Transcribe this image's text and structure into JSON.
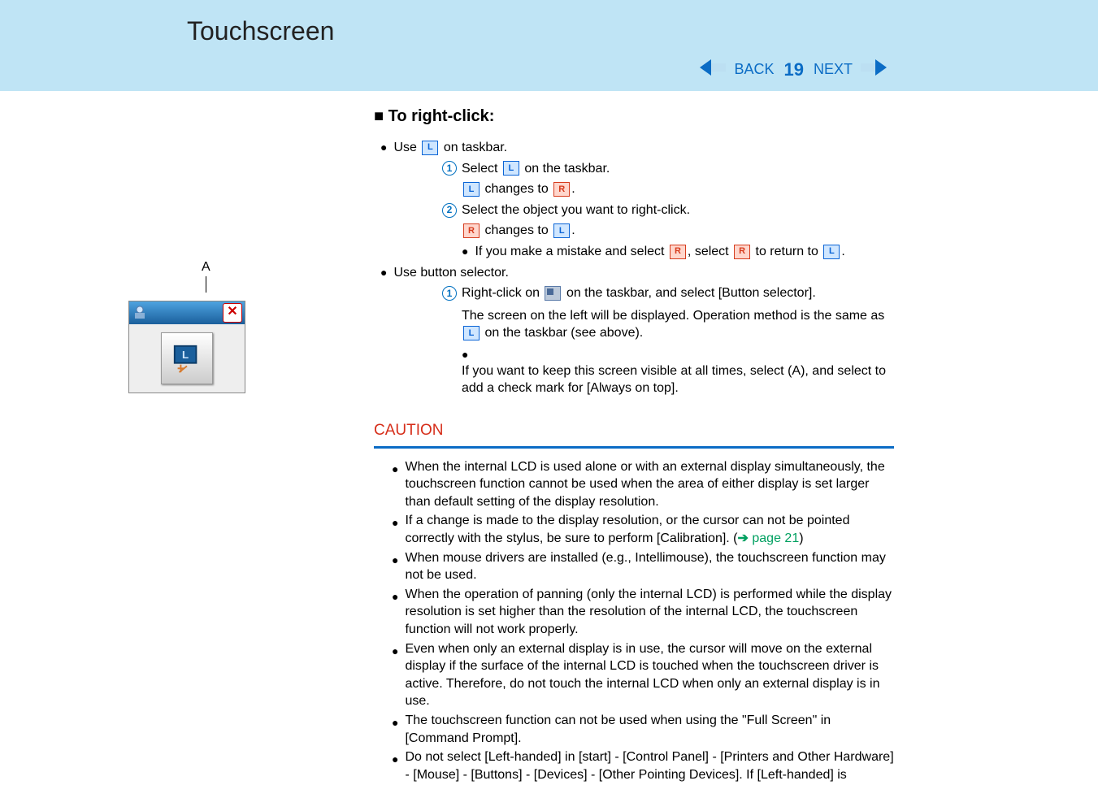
{
  "header": {
    "title": "Touchscreen",
    "back_label": "BACK",
    "page_number": "19",
    "next_label": "NEXT"
  },
  "section": {
    "heading_prefix": "■",
    "heading": "To right-click:",
    "use_taskbar_prefix": "Use",
    "use_taskbar_suffix": "on taskbar.",
    "step1_select": "Select",
    "step1_suffix": "on the taskbar.",
    "changes_to": "changes to",
    "step2": "Select the object you want to right-click.",
    "mistake_prefix": "If you make a mistake and select",
    "mistake_mid": ", select",
    "mistake_suffix": "to return to",
    "use_button_selector": "Use button selector.",
    "rc_prefix": "Right-click on",
    "rc_suffix": "on the taskbar, and select [Button selector].",
    "screen_left_prefix": "The screen on the left will be displayed.  Operation method is the same as",
    "screen_left_suffix": "on the taskbar (see above).",
    "always_on_top": "If you want to keep this screen visible at all times, select (A), and select to add a check mark for [Always on top]."
  },
  "left": {
    "a_label": "A"
  },
  "caution": {
    "heading": "CAUTION",
    "items": [
      "When the internal LCD is used alone or with an external display simultaneously, the touchscreen function cannot be used when the area of either display is set larger than default setting of the display resolution.",
      "If a change is made to the display resolution, or the cursor can not be pointed correctly with the stylus, be sure to perform [Calibration]. (",
      "When mouse drivers are installed (e.g., Intellimouse), the touchscreen function may not be used.",
      "When the operation of panning (only the internal LCD) is performed while the display resolution is set higher than the resolution of the internal LCD, the touchscreen function will not work properly.",
      "Even when only an external display is in use, the cursor will move on the external display if the surface of the internal LCD is touched when the touchscreen driver is active. Therefore, do not touch the internal LCD when only an external display is in use.",
      "The touchscreen function can not be used when using the \"Full Screen\" in [Command Prompt].",
      "Do not select [Left-handed] in [start] - [Control Panel] - [Printers and Other Hardware] - [Mouse] - [Buttons] - [Devices] - [Other Pointing Devices].  If [Left-handed] is"
    ],
    "page_link": "page 21"
  },
  "icons": {
    "l": "L",
    "r": "R"
  }
}
